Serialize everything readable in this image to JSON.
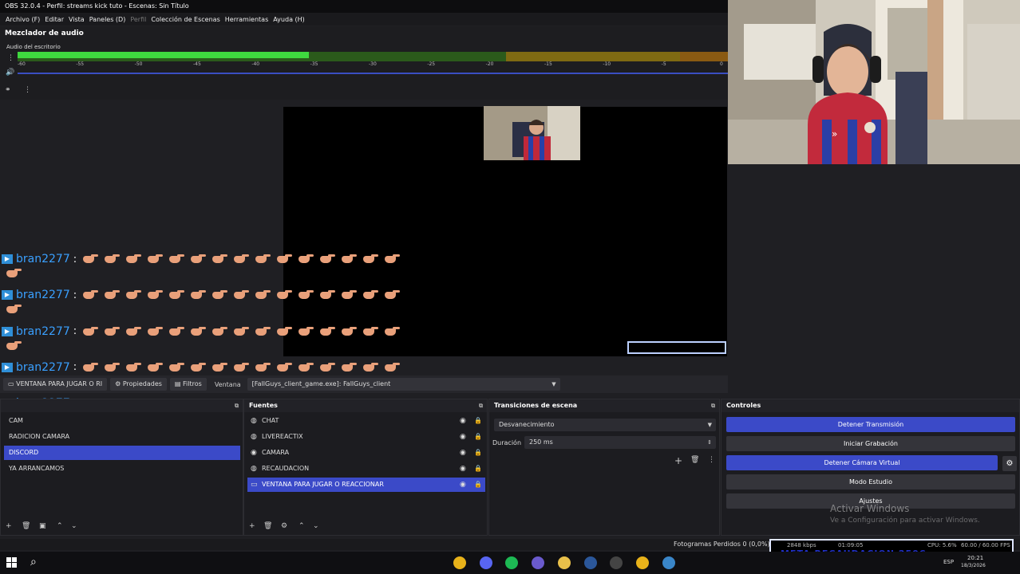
{
  "window_title": "OBS 32.0.4 - Perfil: streams kick tuto - Escenas: Sin Título",
  "menu": [
    {
      "label": "Archivo (F)",
      "dim": false
    },
    {
      "label": "Editar",
      "dim": false
    },
    {
      "label": "Vista",
      "dim": false
    },
    {
      "label": "Paneles (D)",
      "dim": false
    },
    {
      "label": "Perfil",
      "dim": true
    },
    {
      "label": "Colección de Escenas",
      "dim": false
    },
    {
      "label": "Herramientas",
      "dim": false
    },
    {
      "label": "Ayuda (H)",
      "dim": false
    }
  ],
  "mixer": {
    "title": "Mezclador de audio",
    "source_name": "Audio del escritorio",
    "level": 0.41,
    "ticks": [
      "-60",
      "-55",
      "-50",
      "-45",
      "-40",
      "-35",
      "-30",
      "-25",
      "-20",
      "-15",
      "-10",
      "-5",
      "0"
    ]
  },
  "chat": {
    "username": "bran2277",
    "separator": ":",
    "emote_name": "pointing-hand-emote",
    "emotes_per_line": 15,
    "line_count": 8
  },
  "source_toolbar": {
    "selected_source": "VENTANA PARA JUGAR O RI",
    "properties_label": "Propiedades",
    "filters_label": "Filtros",
    "window_label": "Ventana",
    "window_value": "[FallGuys_client_game.exe]: FallGuys_client"
  },
  "scenes_dock": {
    "items": [
      {
        "label": "CAM",
        "selected": false
      },
      {
        "label": "RADICION CAMARA",
        "selected": false
      },
      {
        "label": "DISCORD",
        "selected": true
      },
      {
        "label": "YA ARRANCAMOS",
        "selected": false
      }
    ]
  },
  "sources_dock": {
    "title": "Fuentes",
    "items": [
      {
        "label": "CHAT",
        "selected": false
      },
      {
        "label": "LIVEREACTIX",
        "selected": false
      },
      {
        "label": "CAMARA",
        "selected": false
      },
      {
        "label": "RECAUDACION",
        "selected": false
      },
      {
        "label": "VENTANA PARA JUGAR O REACCIONAR",
        "selected": true
      }
    ]
  },
  "transitions_dock": {
    "title": "Transiciones de escena",
    "transition": "Desvanecimiento",
    "duration_label": "Duración",
    "duration_value": "250 ms"
  },
  "controls_dock": {
    "title": "Controles",
    "buttons": [
      {
        "label": "Detener Transmisión",
        "active": true
      },
      {
        "label": "Iniciar Grabación",
        "active": false
      },
      {
        "label": "Detener Cámara Virtual",
        "active": true
      },
      {
        "label": "Modo Estudio",
        "active": false
      },
      {
        "label": "Ajustes",
        "active": false
      }
    ]
  },
  "watermark": {
    "line1": "Activar Windows",
    "line2": "Ve a Configuración para activar Windows."
  },
  "status": {
    "frames": "Fotogramas Perdidos 0 (0,0%)",
    "bitrate": "2848 kbps",
    "time": "01:09:05",
    "cpu": "CPU: 5.6%",
    "fps": "60.00 / 60.00 FPS",
    "banner": "META RECAUDACION 250€"
  },
  "taskbar": {
    "lang": "ESP",
    "clock_time": "20:21",
    "clock_date": "18/3/2026",
    "apps": [
      {
        "name": "chrome-icon",
        "color": "#e8b21a"
      },
      {
        "name": "discord-icon",
        "color": "#5865f2"
      },
      {
        "name": "spotify-icon",
        "color": "#1db954"
      },
      {
        "name": "gamepad-icon",
        "color": "#6a5acd"
      },
      {
        "name": "folder-icon",
        "color": "#e9c04a"
      },
      {
        "name": "word-icon",
        "color": "#2b579a"
      },
      {
        "name": "obs-icon",
        "color": "#444444"
      },
      {
        "name": "chrome-icon",
        "color": "#e8b21a"
      },
      {
        "name": "store-icon",
        "color": "#3a86c8"
      }
    ]
  },
  "colors": {
    "accent": "#3b4ac8",
    "meter_green": "#3fd83f",
    "chat_user": "#3aa0ff"
  }
}
